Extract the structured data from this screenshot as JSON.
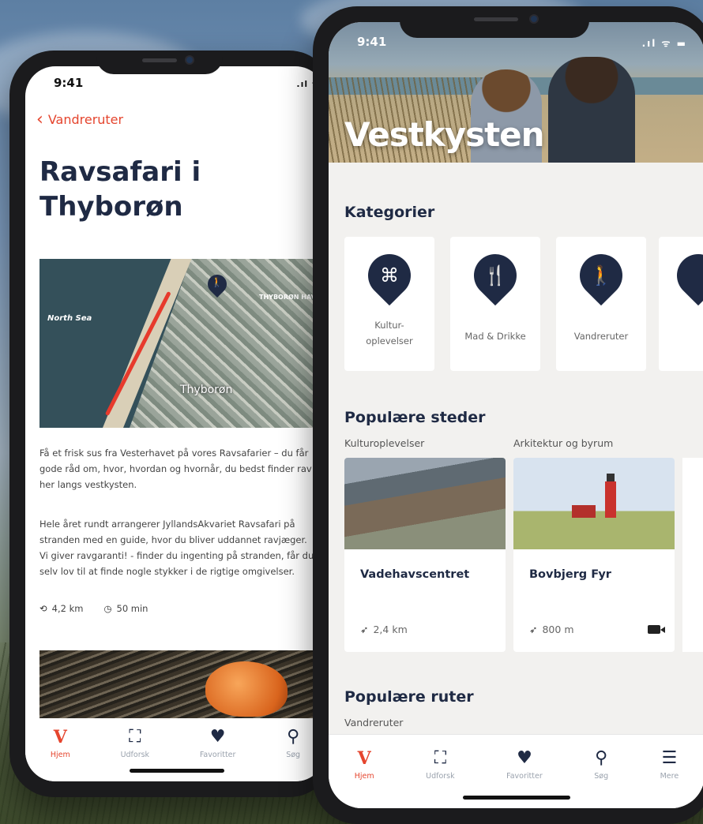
{
  "back_screen": {
    "time": "9:41",
    "back_label": "Vandreruter",
    "title": [
      "Ravsafari i",
      "Thyborøn"
    ],
    "map": {
      "sea_label": "North Sea",
      "town_label": "Thyborøn",
      "harbor_label": "THYBORØN HAVN"
    },
    "paragraph1": "Få et frisk sus fra Vesterhavet på vores Ravsafarier – du får gode råd om, hvor, hvordan og hvornår, du bedst finder rav her langs vestkysten.",
    "paragraph2": "Hele året rundt arrangerer JyllandsAkvariet Ravsafari på stranden med en guide, hvor du bliver uddannet ravjæger. Vi giver ravgaranti! - finder du ingenting på stranden, får du selv lov til at finde nogle stykker i de rigtige omgivelser.",
    "distance": "4,2 km",
    "duration": "50 min",
    "tabs": [
      {
        "label": "Hjem",
        "icon": "V",
        "active": true
      },
      {
        "label": "Udforsk",
        "icon": "map-icon"
      },
      {
        "label": "Favoritter",
        "icon": "heart-icon"
      },
      {
        "label": "Søg",
        "icon": "search-icon"
      }
    ]
  },
  "front_screen": {
    "time": "9:41",
    "hero_title": "Vestkysten",
    "categories_title": "Kategorier",
    "categories": [
      {
        "label": "Kultur-\noplevelser",
        "icon": "culture-icon"
      },
      {
        "label": "Mad & Drikke",
        "icon": "cutlery-icon"
      },
      {
        "label": "Vandreruter",
        "icon": "walking-icon"
      }
    ],
    "popular_places_title": "Populære steder",
    "popular_places": [
      {
        "category": "Kulturoplevelser",
        "name": "Vadehavscentret",
        "distance": "2,4 km",
        "video": false
      },
      {
        "category": "Arkitektur og byrum",
        "name": "Bovbjerg Fyr",
        "distance": "800 m",
        "video": true
      }
    ],
    "popular_routes_title": "Populære ruter",
    "popular_routes_sub": "Vandreruter",
    "tabs": [
      {
        "label": "Hjem",
        "icon": "V",
        "active": true
      },
      {
        "label": "Udforsk",
        "icon": "map-icon"
      },
      {
        "label": "Favoritter",
        "icon": "heart-icon"
      },
      {
        "label": "Søg",
        "icon": "search-icon"
      },
      {
        "label": "Mere",
        "icon": "menu-icon"
      }
    ]
  },
  "colors": {
    "accent": "#e5452e",
    "navy": "#1f2a44"
  }
}
